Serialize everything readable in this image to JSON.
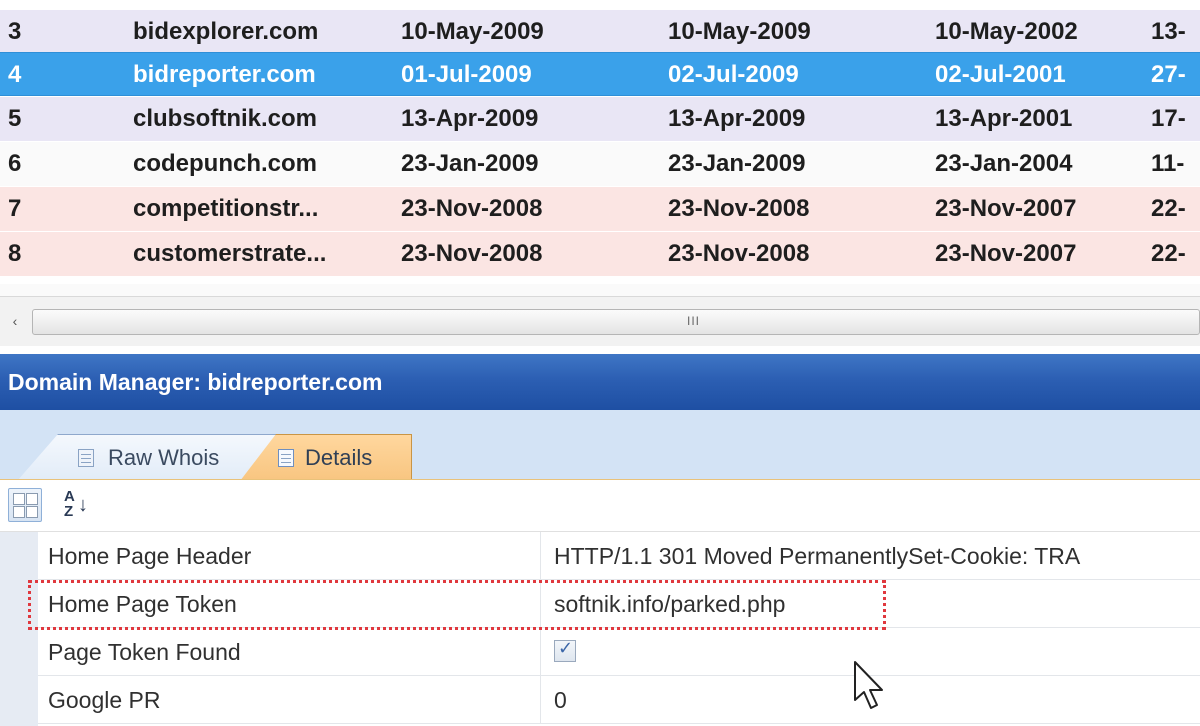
{
  "domains": {
    "rows": [
      {
        "num": "3",
        "name": "bidexplorer.com",
        "d1": "10-May-2009",
        "d2": "10-May-2009",
        "d3": "10-May-2002",
        "d4": "13-"
      },
      {
        "num": "4",
        "name": "bidreporter.com",
        "d1": "01-Jul-2009",
        "d2": "02-Jul-2009",
        "d3": "02-Jul-2001",
        "d4": "27-"
      },
      {
        "num": "5",
        "name": "clubsoftnik.com",
        "d1": "13-Apr-2009",
        "d2": "13-Apr-2009",
        "d3": "13-Apr-2001",
        "d4": "17-"
      },
      {
        "num": "6",
        "name": "codepunch.com",
        "d1": "23-Jan-2009",
        "d2": "23-Jan-2009",
        "d3": "23-Jan-2004",
        "d4": "11-"
      },
      {
        "num": "7",
        "name": "competitionstr...",
        "d1": "23-Nov-2008",
        "d2": "23-Nov-2008",
        "d3": "23-Nov-2007",
        "d4": "22-"
      },
      {
        "num": "8",
        "name": "customerstrate...",
        "d1": "23-Nov-2008",
        "d2": "23-Nov-2008",
        "d3": "23-Nov-2007",
        "d4": "22-"
      }
    ]
  },
  "scrollbar": {
    "left_arrow": "‹",
    "grip": "III"
  },
  "domain_manager": {
    "title": "Domain Manager: bidreporter.com"
  },
  "tabs": [
    {
      "label": "Raw Whois",
      "icon": "document-icon",
      "active": false
    },
    {
      "label": "Details",
      "icon": "grid-icon",
      "active": true
    }
  ],
  "toolbar": {
    "sort_alpha_top": "A",
    "sort_alpha_bottom": "Z",
    "sort_alpha_arrow": "↓"
  },
  "properties": [
    {
      "name": "Home Page Header",
      "value": "HTTP/1.1 301 Moved PermanentlySet-Cookie: TRA"
    },
    {
      "name": "Home Page Token",
      "value": "softnik.info/parked.php"
    },
    {
      "name": "Page Token Found",
      "value": "✓",
      "type": "checkbox",
      "checked": true
    },
    {
      "name": "Google PR",
      "value": "0"
    }
  ],
  "colors": {
    "selected_row": "#3aa1ea",
    "title_bar": "#2c5fb3",
    "active_tab": "#f8c580",
    "highlight": "#e0383e"
  }
}
